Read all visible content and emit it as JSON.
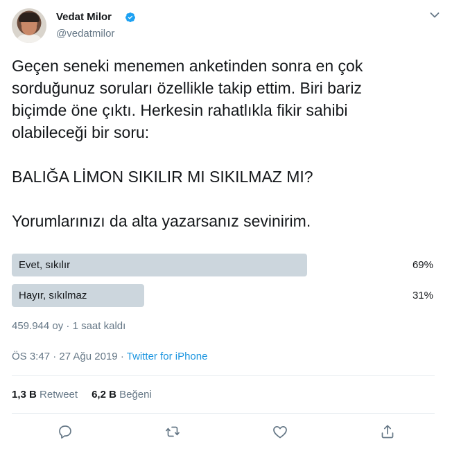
{
  "author": {
    "name": "Vedat Milor",
    "handle": "@vedatmilor",
    "verified": true
  },
  "tweet": {
    "text": "Geçen seneki menemen anketinden sonra en çok\nsorduğunuz soruları özellikle takip ettim. Biri bariz\nbiçimde öne çıktı. Herkesin rahatlıkla fikir sahibi\nolabileceği bir soru:\n\nBALIĞA LİMON SIKILIR MI SIKILMAZ MI?\n\nYorumlarınızı da alta yazarsanız sevinirim."
  },
  "poll": {
    "options": [
      {
        "label": "Evet, sıkılır",
        "percent": "69%",
        "fraction": 0.69
      },
      {
        "label": "Hayır, sıkılmaz",
        "percent": "31%",
        "fraction": 0.31
      }
    ],
    "votes": "459.944 oy",
    "separator": "·",
    "time_left": "1 saat kaldı"
  },
  "meta": {
    "time": "ÖS 3:47",
    "date": "27 Ağu 2019",
    "separator": "·",
    "source": "Twitter for iPhone"
  },
  "stats": {
    "retweets_count": "1,3 B",
    "retweets_label": "Retweet",
    "likes_count": "6,2 B",
    "likes_label": "Beğeni"
  },
  "actions": [
    "reply-icon",
    "retweet-icon",
    "like-icon",
    "share-icon"
  ],
  "colors": {
    "text": "#14171a",
    "secondary": "#657786",
    "link": "#1b95e0",
    "poll_bar": "#ccd6dd",
    "divider": "#e6ecf0"
  }
}
